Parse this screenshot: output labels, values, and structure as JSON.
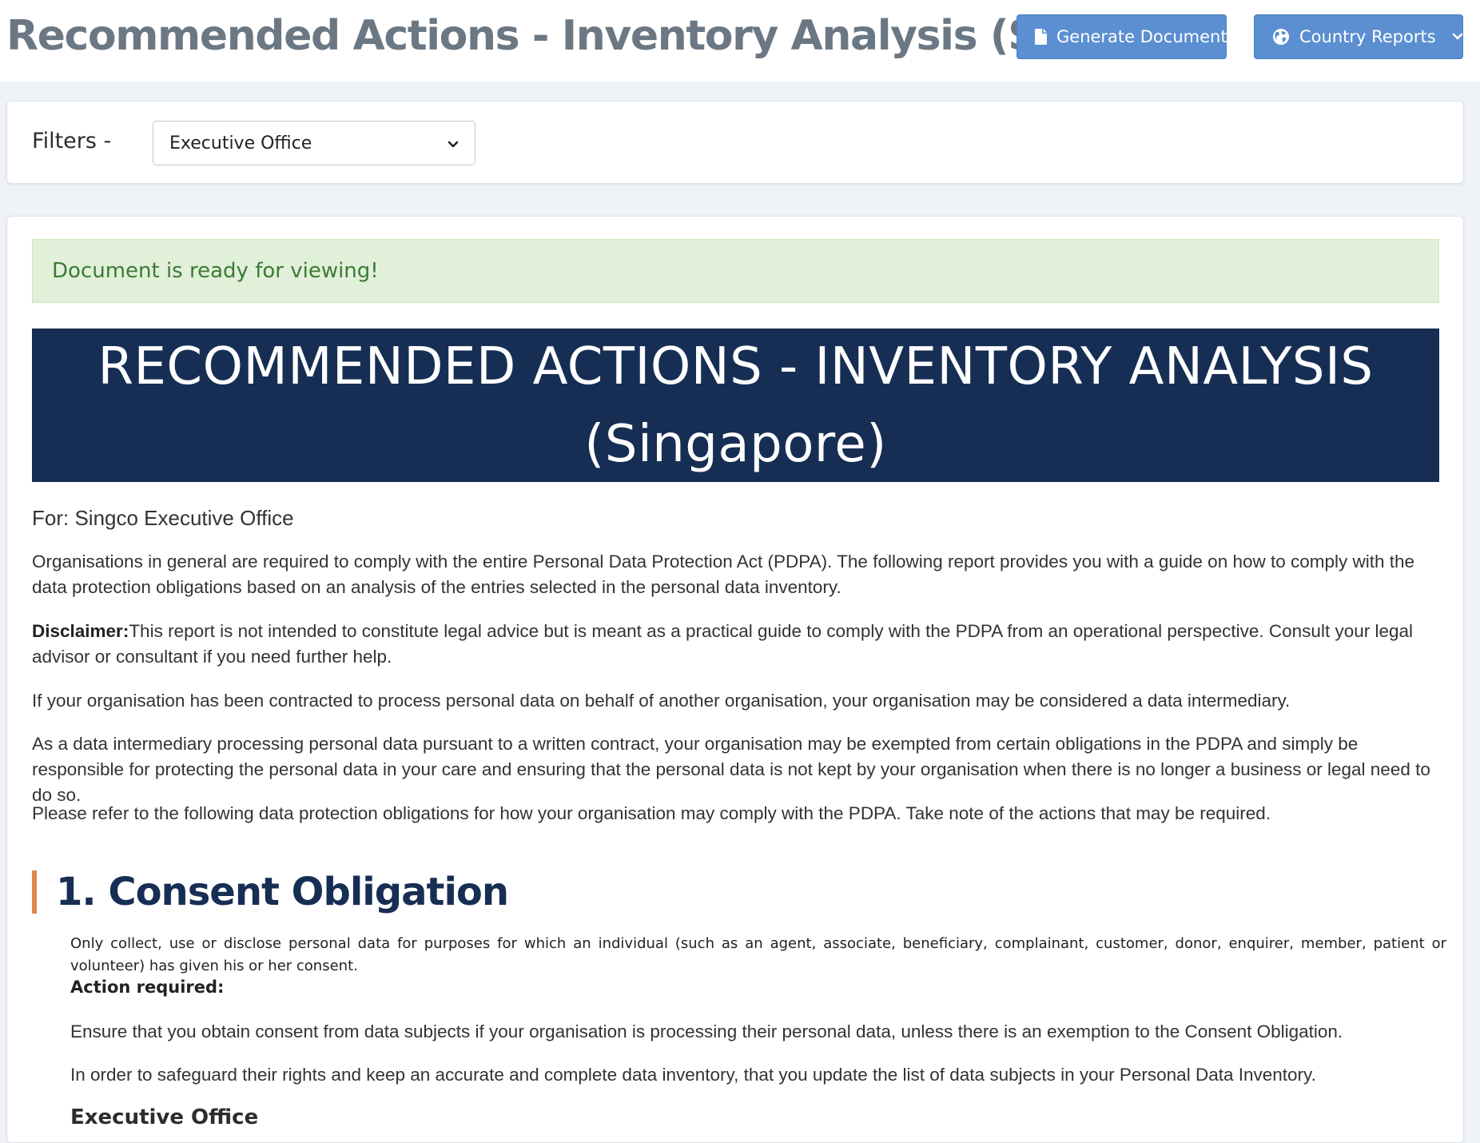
{
  "header": {
    "title": "Recommended Actions - Inventory Analysis (SG)",
    "generate_button": "Generate Document",
    "country_reports_button": "Country Reports"
  },
  "filters": {
    "label": "Filters  -",
    "selected": "Executive Office"
  },
  "document": {
    "alert": "Document is ready for viewing!",
    "banner_line1": "RECOMMENDED ACTIONS - INVENTORY ANALYSIS",
    "banner_line2": "(Singapore)",
    "for_line": "For: Singco Executive Office",
    "para1": "Organisations in general are required to comply with the entire Personal Data Protection Act (PDPA). The following report provides you with a guide on how to comply with the data protection obligations based on an analysis of the entries selected in the personal data inventory.",
    "disclaimer_label": "Disclaimer:",
    "disclaimer_text": "This report is not intended to constitute legal advice but is meant as a practical guide to comply with the PDPA from an operational perspective. Consult your legal advisor or consultant if you need further help.",
    "para3": "If your organisation has been contracted to process personal data on behalf of another organisation, your organisation may be considered a data intermediary.",
    "para4": "As a data intermediary processing personal data pursuant to a written contract, your organisation may be exempted from certain obligations in the PDPA and simply be responsible for protecting the personal data in your care and ensuring that the personal data is not kept by your organisation when there is no longer a business or legal need to do so.",
    "para5": "Please refer to the following data protection obligations for how your organisation may comply with the PDPA. Take note of the actions that may be required.",
    "section1": {
      "heading": "1. Consent Obligation",
      "description": "Only collect, use or disclose personal data for purposes for which an individual (such as an agent, associate, beneficiary, complainant, customer, donor, enquirer, member, patient or volunteer) has given his or her consent.",
      "action_label": "Action required:",
      "action_p1": "Ensure that you obtain consent from data subjects if your organisation is processing their personal data, unless there is an exemption to the Consent Obligation.",
      "action_p2": "In order to safeguard their rights and keep an accurate and complete data inventory, that you update the list of data subjects in your Personal Data Inventory.",
      "subheading": "Executive Office"
    }
  },
  "colors": {
    "primary_button": "#5b8fd1",
    "banner": "#172e54",
    "alert_bg": "#e1f0d8",
    "alert_text": "#3d7a36",
    "section_accent": "#e0894a"
  },
  "icons": {
    "generate": "file-icon",
    "country": "globe-icon",
    "caret": "chevron-down-icon"
  }
}
